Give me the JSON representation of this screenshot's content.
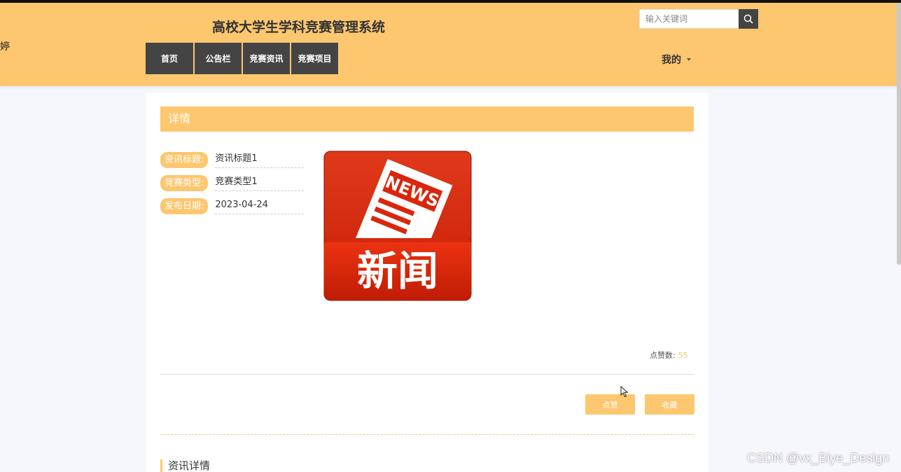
{
  "header": {
    "edge_glyph": "婷",
    "title": "高校大学生学科竞赛管理系统",
    "search": {
      "placeholder": "输入关键词",
      "icon": "search-icon"
    },
    "nav": [
      {
        "label": "首页"
      },
      {
        "label": "公告栏"
      },
      {
        "label": "竞赛资讯"
      },
      {
        "label": "竞赛项目"
      }
    ],
    "user_menu": {
      "label": "我的",
      "icon": "caret-down-icon"
    }
  },
  "detail": {
    "section_title": "详情",
    "fields": [
      {
        "label": "资讯标题:",
        "value": "资讯标题1"
      },
      {
        "label": "竞赛类型:",
        "value": "竞赛类型1"
      },
      {
        "label": "发布日期:",
        "value": "2023-04-24"
      }
    ],
    "image": {
      "top_word": "NEWS",
      "bottom_word": "新闻"
    },
    "likes": {
      "label": "点赞数:",
      "count": "55"
    },
    "buttons": {
      "like": "点赞",
      "favorite": "收藏"
    },
    "content_heading": "资讯详情"
  },
  "watermark": "CSDN @vx_Biye_Design",
  "colors": {
    "accent": "#fdc76f",
    "nav_bg": "#444444",
    "image_red": "#d9260c"
  }
}
